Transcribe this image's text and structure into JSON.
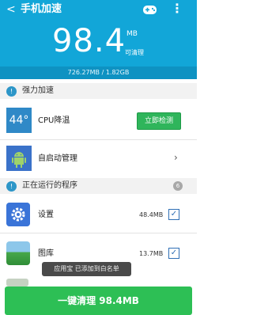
{
  "header": {
    "back_glyph": "<",
    "title": "手机加速",
    "game_icon": "gamepad-icon",
    "more_glyph": "⋮"
  },
  "memory": {
    "value": "98.4",
    "unit": "MB",
    "clean_label": "可清理",
    "usage": "726.27MB / 1.82GB"
  },
  "sections": {
    "boost": {
      "icon": "!",
      "label": "强力加速"
    },
    "running": {
      "icon": "!",
      "label": "正在运行的程序",
      "count": "6"
    }
  },
  "cpu": {
    "temperature": "44°",
    "label": "CPU降温",
    "button": "立即检测"
  },
  "autostart": {
    "label": "自启动管理",
    "chevron": "›"
  },
  "apps": [
    {
      "name": "设置",
      "size": "48.4MB",
      "checked": "✓",
      "icon": "gear-icon"
    },
    {
      "name": "图库",
      "size": "13.7MB",
      "checked": "✓",
      "icon": "gallery-icon"
    }
  ],
  "toast": "应用宝 已添加到白名单",
  "footer": {
    "button": "一键清理 98.4MB"
  },
  "colors": {
    "header": "#12a6d8",
    "button_green": "#2dbf55",
    "check_green": "#2fb55b"
  }
}
